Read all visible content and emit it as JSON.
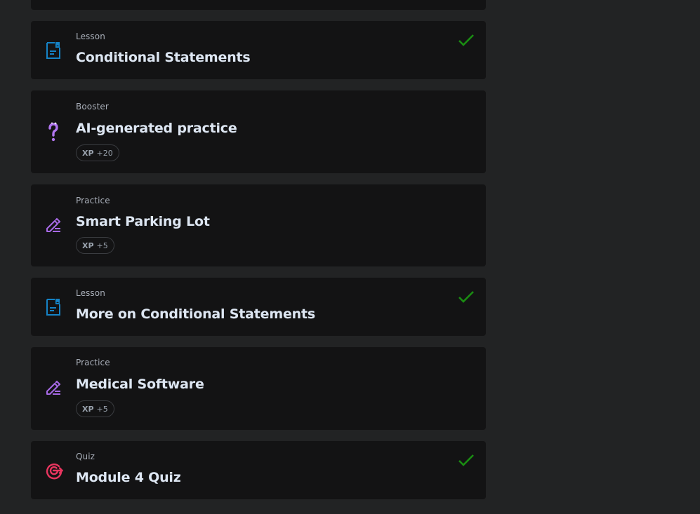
{
  "colors": {
    "page_bg": "#222324",
    "card_bg": "#131314",
    "lesson_icon": "#1583c6",
    "booster_icon": "#b176f0",
    "practice_icon": "#a76ae6",
    "quiz_icon": "#e8355f",
    "check": "#1a8c12"
  },
  "items": [
    {
      "kind": "Lesson",
      "title": "Conditional Statements",
      "icon": "document-icon",
      "completed": true
    },
    {
      "kind": "Booster",
      "title": "AI-generated practice",
      "icon": "ai-question-icon",
      "xp_label": "XP",
      "xp_value": "+20",
      "completed": false
    },
    {
      "kind": "Practice",
      "title": "Smart Parking Lot",
      "icon": "pencil-icon",
      "xp_label": "XP",
      "xp_value": "+5",
      "completed": false
    },
    {
      "kind": "Lesson",
      "title": "More on Conditional Statements",
      "icon": "document-icon",
      "completed": true
    },
    {
      "kind": "Practice",
      "title": "Medical Software",
      "icon": "pencil-icon",
      "xp_label": "XP",
      "xp_value": "+5",
      "completed": false
    },
    {
      "kind": "Quiz",
      "title": "Module 4 Quiz",
      "icon": "target-icon",
      "completed": true
    }
  ]
}
